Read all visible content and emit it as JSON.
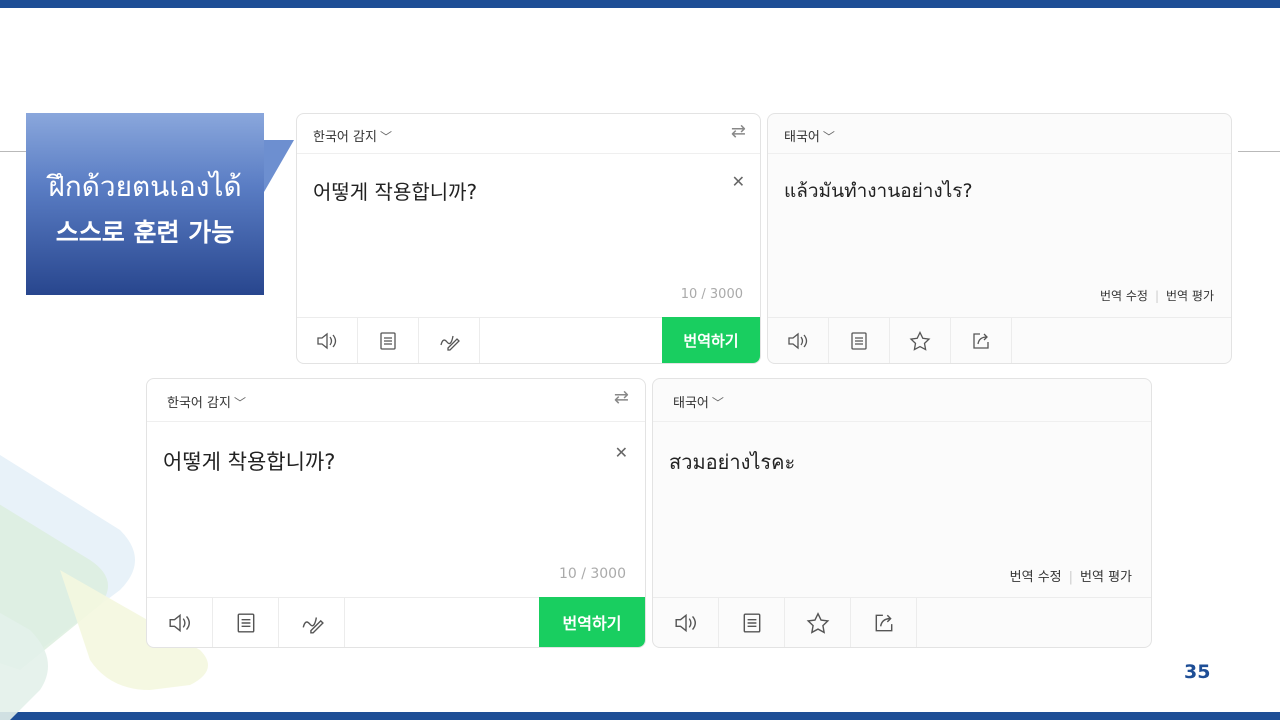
{
  "callout": {
    "thai": "ฝึกด้วยตนเองได้",
    "korean": "스스로 훈련 가능"
  },
  "translator_top": {
    "source_lang": "한국어 감지",
    "source_text": "어떻게 작용합니까?",
    "char_count": "10 / 3000",
    "translate_button": "번역하기",
    "target_lang": "태국어",
    "target_text": "แล้วมันทำงานอย่างไร?",
    "edit_translation": "번역 수정",
    "rate_translation": "번역 평가"
  },
  "translator_bottom": {
    "source_lang": "한국어 감지",
    "source_text": "어떻게 착용합니까?",
    "char_count": "10 / 3000",
    "translate_button": "번역하기",
    "target_lang": "태국어",
    "target_text": "สวมอย่างไรคะ",
    "edit_translation": "번역 수정",
    "rate_translation": "번역 평가"
  },
  "icons": [
    "speaker-icon",
    "document-icon",
    "handwriting-icon",
    "star-icon",
    "share-icon",
    "swap-icon",
    "close-icon",
    "chevron-down-icon"
  ],
  "colors": {
    "accent_bar": "#1e4e96",
    "translate_button": "#19ce60"
  },
  "page_number": "35"
}
